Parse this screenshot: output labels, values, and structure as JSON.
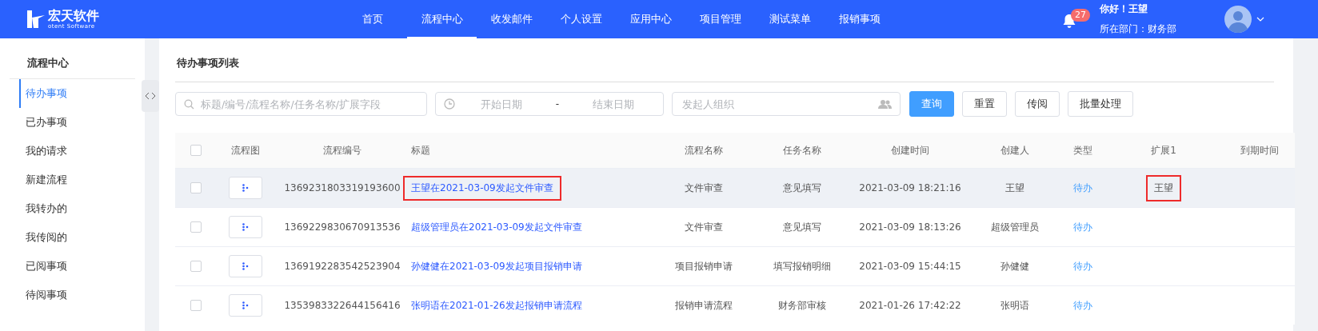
{
  "header": {
    "brand": "宏天软件",
    "brand_sub": "otent Software",
    "nav": [
      {
        "label": "首页",
        "selected": false
      },
      {
        "label": "流程中心",
        "selected": true
      },
      {
        "label": "收发邮件",
        "selected": false
      },
      {
        "label": "个人设置",
        "selected": false
      },
      {
        "label": "应用中心",
        "selected": false
      },
      {
        "label": "项目管理",
        "selected": false
      },
      {
        "label": "测试菜单",
        "selected": false
      },
      {
        "label": "报销事项",
        "selected": false
      }
    ],
    "notification_count": "27",
    "greeting": "你好！王望",
    "department": "所在部门：财务部"
  },
  "sidebar": {
    "title": "流程中心",
    "items": [
      {
        "label": "待办事项",
        "selected": true
      },
      {
        "label": "已办事项",
        "selected": false
      },
      {
        "label": "我的请求",
        "selected": false
      },
      {
        "label": "新建流程",
        "selected": false
      },
      {
        "label": "我转办的",
        "selected": false
      },
      {
        "label": "我传阅的",
        "selected": false
      },
      {
        "label": "已阅事项",
        "selected": false
      },
      {
        "label": "待阅事项",
        "selected": false
      }
    ]
  },
  "panel": {
    "title": "待办事项列表",
    "filters": {
      "search_placeholder": "标题/编号/流程名称/任务名称/扩展字段",
      "start_placeholder": "开始日期",
      "separator": "-",
      "end_placeholder": "结束日期",
      "org_placeholder": "发起人组织"
    },
    "buttons": [
      {
        "label": "查询",
        "kind": "primary"
      },
      {
        "label": "重置",
        "kind": "default"
      },
      {
        "label": "传阅",
        "kind": "default"
      },
      {
        "label": "批量处理",
        "kind": "default"
      }
    ],
    "table": {
      "all_checked": false,
      "columns": [
        "流程图",
        "流程编号",
        "标题",
        "流程名称",
        "任务名称",
        "创建时间",
        "创建人",
        "类型",
        "扩展1",
        "到期时间"
      ],
      "rows": [
        {
          "checked": false,
          "hovered": true,
          "number": "1369231803319193600",
          "title": "王望在2021-03-09发起文件审查",
          "title_highlighted": true,
          "process": "文件审查",
          "task": "意见填写",
          "created": "2021-03-09 18:21:16",
          "creator": "王望",
          "type": "待办",
          "ext1": "王望",
          "ext1_highlighted": true
        },
        {
          "checked": false,
          "hovered": false,
          "number": "1369229830670913536",
          "title": "超级管理员在2021-03-09发起文件审查",
          "title_highlighted": false,
          "process": "文件审查",
          "task": "意见填写",
          "created": "2021-03-09 18:13:26",
          "creator": "超级管理员",
          "type": "待办"
        },
        {
          "checked": false,
          "hovered": false,
          "number": "1369192283542523904",
          "title": "孙健健在2021-03-09发起项目报销申请",
          "title_highlighted": false,
          "process": "项目报销申请",
          "task": "填写报销明细",
          "created": "2021-03-09 15:44:15",
          "creator": "孙健健",
          "type": "待办"
        },
        {
          "checked": false,
          "hovered": false,
          "number": "1353983322644156416",
          "title": "张明语在2021-01-26发起报销申请流程",
          "title_highlighted": false,
          "process": "报销申请流程",
          "task": "财务部审核",
          "created": "2021-01-26 17:42:22",
          "creator": "张明语",
          "type": "待办"
        }
      ]
    }
  }
}
